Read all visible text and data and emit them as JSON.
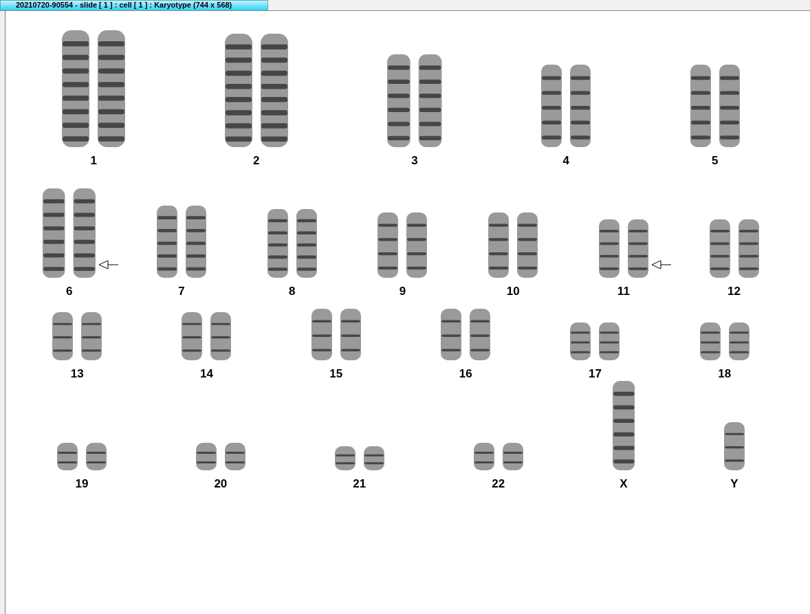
{
  "window": {
    "title": "20210720-90554 - slide [ 1 ] : cell [ 1 ] : Karyotype  (744 x 568)"
  },
  "rows": [
    {
      "chromosomes": [
        {
          "label": "1",
          "kind": "pair",
          "marked": false
        },
        {
          "label": "2",
          "kind": "pair",
          "marked": false
        },
        {
          "label": "3",
          "kind": "pair",
          "marked": false
        },
        {
          "label": "4",
          "kind": "pair",
          "marked": false
        },
        {
          "label": "5",
          "kind": "pair",
          "marked": false
        }
      ]
    },
    {
      "chromosomes": [
        {
          "label": "6",
          "kind": "pair",
          "marked": true
        },
        {
          "label": "7",
          "kind": "pair",
          "marked": false
        },
        {
          "label": "8",
          "kind": "pair",
          "marked": false
        },
        {
          "label": "9",
          "kind": "pair",
          "marked": false
        },
        {
          "label": "10",
          "kind": "pair",
          "marked": false
        },
        {
          "label": "11",
          "kind": "pair",
          "marked": true
        },
        {
          "label": "12",
          "kind": "pair",
          "marked": false
        }
      ]
    },
    {
      "chromosomes": [
        {
          "label": "13",
          "kind": "pair",
          "marked": false
        },
        {
          "label": "14",
          "kind": "pair",
          "marked": false
        },
        {
          "label": "15",
          "kind": "pair",
          "marked": false
        },
        {
          "label": "16",
          "kind": "pair",
          "marked": false
        },
        {
          "label": "17",
          "kind": "pair",
          "marked": false
        },
        {
          "label": "18",
          "kind": "pair",
          "marked": false
        }
      ]
    },
    {
      "chromosomes": [
        {
          "label": "19",
          "kind": "pair",
          "marked": false
        },
        {
          "label": "20",
          "kind": "pair",
          "marked": false
        },
        {
          "label": "21",
          "kind": "pair",
          "marked": false
        },
        {
          "label": "22",
          "kind": "pair",
          "marked": false
        },
        {
          "label": "X",
          "kind": "single",
          "marked": false
        },
        {
          "label": "Y",
          "kind": "single",
          "marked": false
        }
      ]
    }
  ]
}
